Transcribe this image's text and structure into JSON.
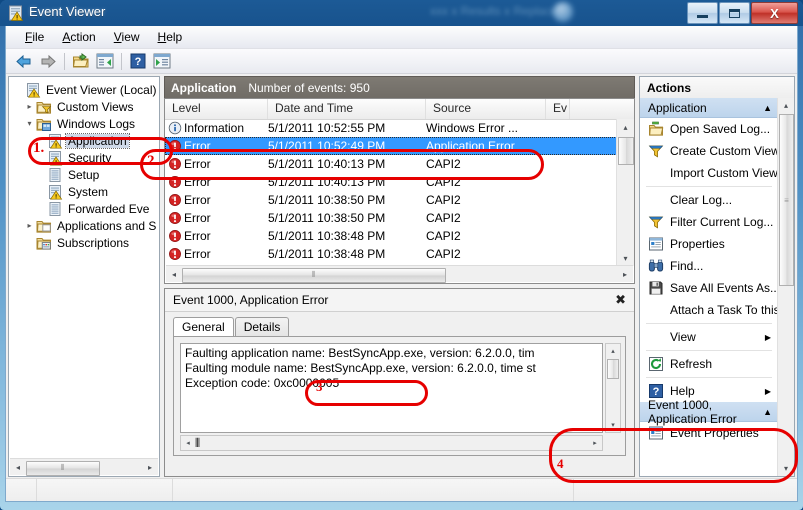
{
  "window": {
    "title": "Event Viewer",
    "ghost_title": "xxx x Results x Replace",
    "minimize_label": "Minimize",
    "maximize_label": "Maximize",
    "close_label": "X"
  },
  "menu": [
    {
      "label": "File",
      "accel": "F"
    },
    {
      "label": "Action",
      "accel": "A"
    },
    {
      "label": "View",
      "accel": "V"
    },
    {
      "label": "Help",
      "accel": "H"
    }
  ],
  "toolbar": [
    {
      "name": "back-icon",
      "glyph": "←"
    },
    {
      "name": "forward-icon",
      "glyph": "→"
    },
    {
      "name": "separator",
      "glyph": ""
    },
    {
      "name": "show-hide-console-tree-icon",
      "glyph": "▤"
    },
    {
      "name": "show-hide-action-pane-icon",
      "glyph": "▥"
    },
    {
      "name": "separator",
      "glyph": ""
    },
    {
      "name": "help-icon",
      "glyph": "?"
    },
    {
      "name": "show-hide-preview-pane-icon",
      "glyph": "▦"
    }
  ],
  "tree": {
    "items": [
      {
        "label": "Event Viewer (Local)",
        "indent": 0,
        "twist": "",
        "icon": "event-viewer-icon",
        "selected": false
      },
      {
        "label": "Custom Views",
        "indent": 1,
        "twist": "▸",
        "icon": "custom-views-folder-icon",
        "selected": false
      },
      {
        "label": "Windows Logs",
        "indent": 1,
        "twist": "▾",
        "icon": "windows-logs-folder-icon",
        "selected": false
      },
      {
        "label": "Application",
        "indent": 2,
        "twist": "",
        "icon": "log-icon",
        "selected": true
      },
      {
        "label": "Security",
        "indent": 2,
        "twist": "",
        "icon": "log-icon",
        "selected": false
      },
      {
        "label": "Setup",
        "indent": 2,
        "twist": "",
        "icon": "plain-log-icon",
        "selected": false
      },
      {
        "label": "System",
        "indent": 2,
        "twist": "",
        "icon": "log-icon",
        "selected": false
      },
      {
        "label": "Forwarded Eve",
        "indent": 2,
        "twist": "",
        "icon": "plain-log-icon",
        "selected": false
      },
      {
        "label": "Applications and S",
        "indent": 1,
        "twist": "▸",
        "icon": "apps-services-folder-icon",
        "selected": false
      },
      {
        "label": "Subscriptions",
        "indent": 1,
        "twist": "",
        "icon": "subscriptions-icon",
        "selected": false
      }
    ]
  },
  "list": {
    "header_log_name": "Application",
    "header_event_count": "Number of events: 950",
    "columns": [
      "Level",
      "Date and Time",
      "Source",
      "Ev"
    ],
    "rows": [
      {
        "level": "Information",
        "datetime": "5/1/2011 10:52:55 PM",
        "source": "Windows Error ...",
        "icon": "information-icon",
        "selected": false
      },
      {
        "level": "Error",
        "datetime": "5/1/2011 10:52:49 PM",
        "source": "Application Error",
        "icon": "error-icon",
        "selected": true
      },
      {
        "level": "Error",
        "datetime": "5/1/2011 10:40:13 PM",
        "source": "CAPI2",
        "icon": "error-icon",
        "selected": false
      },
      {
        "level": "Error",
        "datetime": "5/1/2011 10:40:13 PM",
        "source": "CAPI2",
        "icon": "error-icon",
        "selected": false
      },
      {
        "level": "Error",
        "datetime": "5/1/2011 10:38:50 PM",
        "source": "CAPI2",
        "icon": "error-icon",
        "selected": false
      },
      {
        "level": "Error",
        "datetime": "5/1/2011 10:38:50 PM",
        "source": "CAPI2",
        "icon": "error-icon",
        "selected": false
      },
      {
        "level": "Error",
        "datetime": "5/1/2011 10:38:48 PM",
        "source": "CAPI2",
        "icon": "error-icon",
        "selected": false
      },
      {
        "level": "Error",
        "datetime": "5/1/2011 10:38:48 PM",
        "source": "CAPI2",
        "icon": "error-icon",
        "selected": false
      }
    ]
  },
  "detail": {
    "title": "Event 1000, Application Error",
    "close_glyph": "✖",
    "tabs": [
      {
        "label": "General",
        "active": true
      },
      {
        "label": "Details",
        "active": false
      }
    ],
    "body_lines": [
      "Faulting application name: BestSyncApp.exe, version: 6.2.0.0, tim",
      "Faulting module name: BestSyncApp.exe, version: 6.2.0.0, time st",
      "Exception code: 0xc0000005"
    ]
  },
  "actions": {
    "header": "Actions",
    "group1": {
      "label": "Application",
      "collapse_glyph": "▲"
    },
    "group1_items": [
      {
        "label": "Open Saved Log...",
        "icon": "open-folder-icon",
        "sep_after": false
      },
      {
        "label": "Create Custom View...",
        "icon": "filter-funnel-icon",
        "sep_after": false
      },
      {
        "label": "Import Custom View...",
        "icon": "",
        "sep_after": true
      },
      {
        "label": "Clear Log...",
        "icon": "",
        "sep_after": false
      },
      {
        "label": "Filter Current Log...",
        "icon": "filter-funnel-icon",
        "sep_after": false
      },
      {
        "label": "Properties",
        "icon": "properties-icon",
        "sep_after": false
      },
      {
        "label": "Find...",
        "icon": "binoculars-icon",
        "sep_after": false
      },
      {
        "label": "Save All Events As...",
        "icon": "save-disk-icon",
        "sep_after": false
      },
      {
        "label": "Attach a Task To this Log...",
        "icon": "",
        "sep_after": true
      },
      {
        "label": "View",
        "icon": "",
        "submenu": "▶",
        "sep_after": true
      },
      {
        "label": "Refresh",
        "icon": "refresh-icon",
        "sep_after": true
      },
      {
        "label": "Help",
        "icon": "help-icon",
        "submenu": "▶",
        "sep_after": false
      }
    ],
    "group2": {
      "label": "Event 1000, Application Error",
      "collapse_glyph": "▲"
    },
    "group2_items": [
      {
        "label": "Event Properties",
        "icon": "properties-icon"
      }
    ]
  },
  "annotations": [
    {
      "number": "1.",
      "target": "tree-item-application"
    },
    {
      "number": "2.",
      "target": "list-row-application-error"
    },
    {
      "number": "3",
      "target": "detail-bestsyncapp-exe"
    },
    {
      "number": "4",
      "target": "action-event-properties"
    }
  ],
  "scroll": {
    "left_arrow": "◂",
    "right_arrow": "▸",
    "up_arrow": "▴",
    "down_arrow": "▾",
    "grip": "⫴"
  }
}
